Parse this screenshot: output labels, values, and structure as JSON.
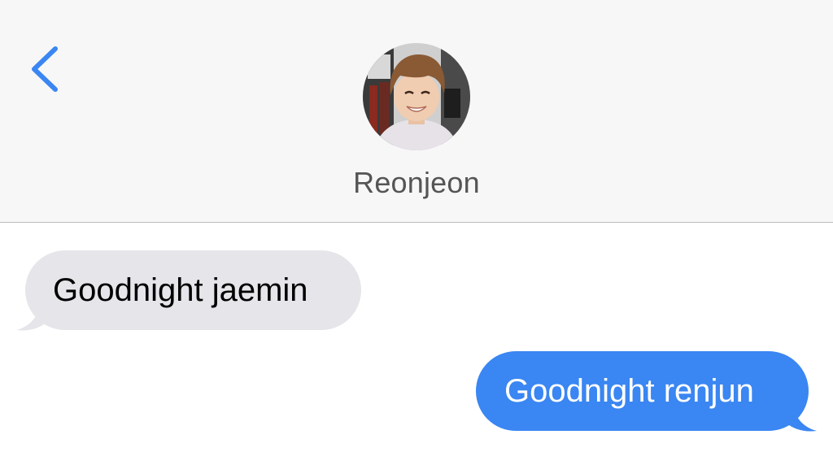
{
  "header": {
    "back_icon": "chevron-left-icon",
    "contact_name": "Reonjeon",
    "accent_color": "#3a86f2"
  },
  "messages": [
    {
      "direction": "incoming",
      "text": "Goodnight jaemin",
      "bubble_color": "#e5e5ea"
    },
    {
      "direction": "outgoing",
      "text": "Goodnight renjun",
      "bubble_color": "#3a86f2"
    }
  ]
}
